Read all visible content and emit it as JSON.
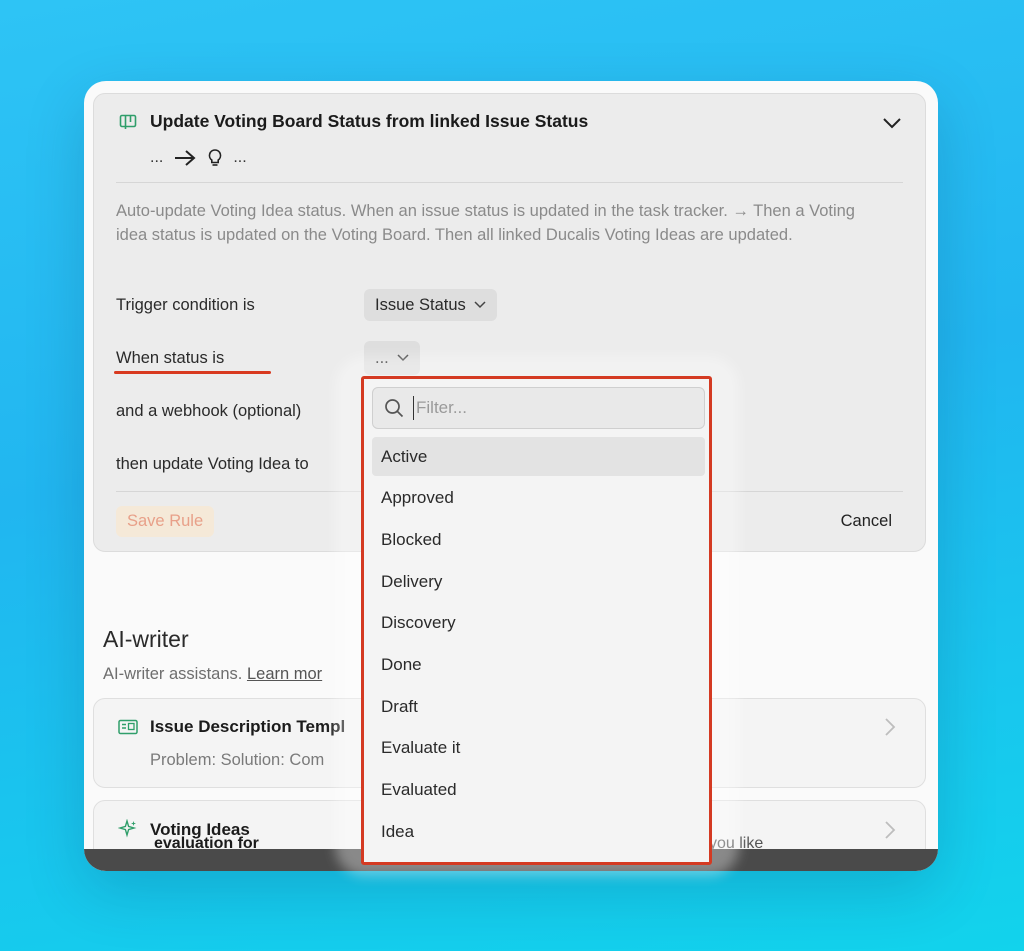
{
  "rule": {
    "title": "Update Voting Board Status from linked Issue Status",
    "flow_left": "...",
    "flow_right": "...",
    "description": "Auto-update Voting Idea status. When an issue status is updated in the task tracker. → Then a Voting idea status is updated on the Voting Board. Then all linked Ducalis Voting Ideas are updated.",
    "rows": {
      "trigger_label": "Trigger condition is",
      "trigger_value": "Issue Status",
      "status_label": "When status is",
      "status_value": "...",
      "webhook_label": "and a webhook (optional)",
      "update_label": "then update Voting Idea to"
    },
    "save_label": "Save Rule",
    "cancel_label": "Cancel"
  },
  "ai_writer": {
    "title": "AI-writer",
    "subtitle": "AI-writer assistans.",
    "learn_more": "Learn mor",
    "items": [
      {
        "title": "Issue Description Templ",
        "sub": "Problem:  Solution:  Com"
      },
      {
        "title": "Voting Ideas",
        "sub": "evaluation for"
      }
    ],
    "ghost_text": "you like"
  },
  "dropdown": {
    "filter_placeholder": "Filter...",
    "options": [
      "Active",
      "Approved",
      "Blocked",
      "Delivery",
      "Discovery",
      "Done",
      "Draft",
      "Evaluate it",
      "Evaluated",
      "Idea"
    ],
    "highlighted": "Active"
  },
  "colors": {
    "highlight_border": "#d43a22",
    "accent_green": "#2f9e6a",
    "background": "#21b6f0"
  }
}
